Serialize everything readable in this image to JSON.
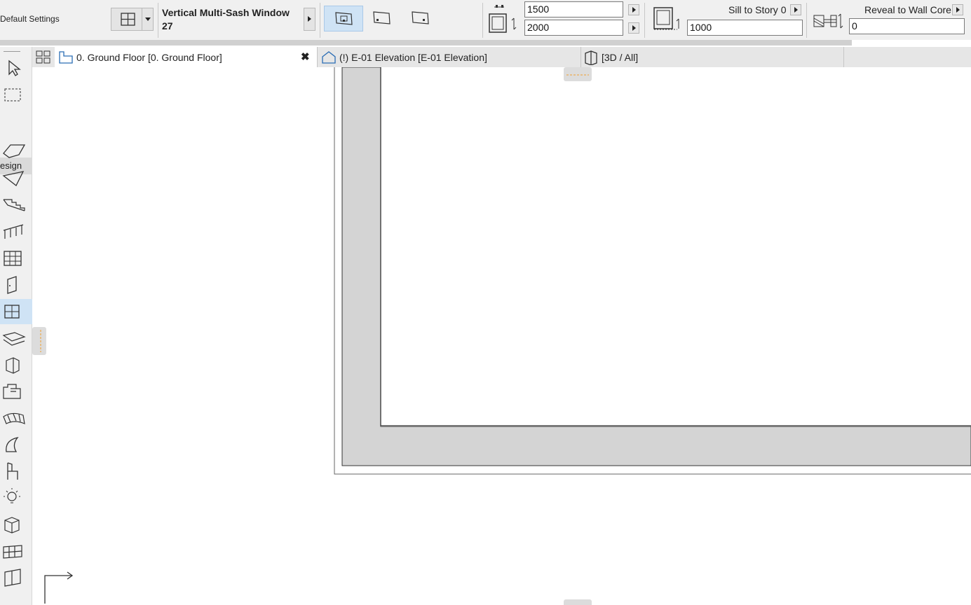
{
  "infobox": {
    "settings_label": "Default Settings",
    "window_name_line1": "Vertical Multi-Sash Window",
    "window_name_line2": "27",
    "width_value": "1500",
    "height_value": "2000",
    "sill_label": "Sill to Story 0",
    "sill_value": "1000",
    "reveal_label": "Reveal to Wall Core",
    "reveal_value": "0"
  },
  "toolbox": {
    "section_label": "esign",
    "active_tool": "window-tool",
    "accent_color": "#cfe3f5"
  },
  "tabs": [
    {
      "label": "0. Ground Floor [0. Ground Floor]",
      "icon": "floor-plan-icon",
      "active": true
    },
    {
      "label": "(!) E-01 Elevation [E-01 Elevation]",
      "icon": "elevation-icon",
      "active": false
    },
    {
      "label": "[3D / All]",
      "icon": "3d-view-icon",
      "active": false
    }
  ],
  "colors": {
    "wall_fill": "#d4d4d4",
    "selection_marker": "#f0a030"
  }
}
